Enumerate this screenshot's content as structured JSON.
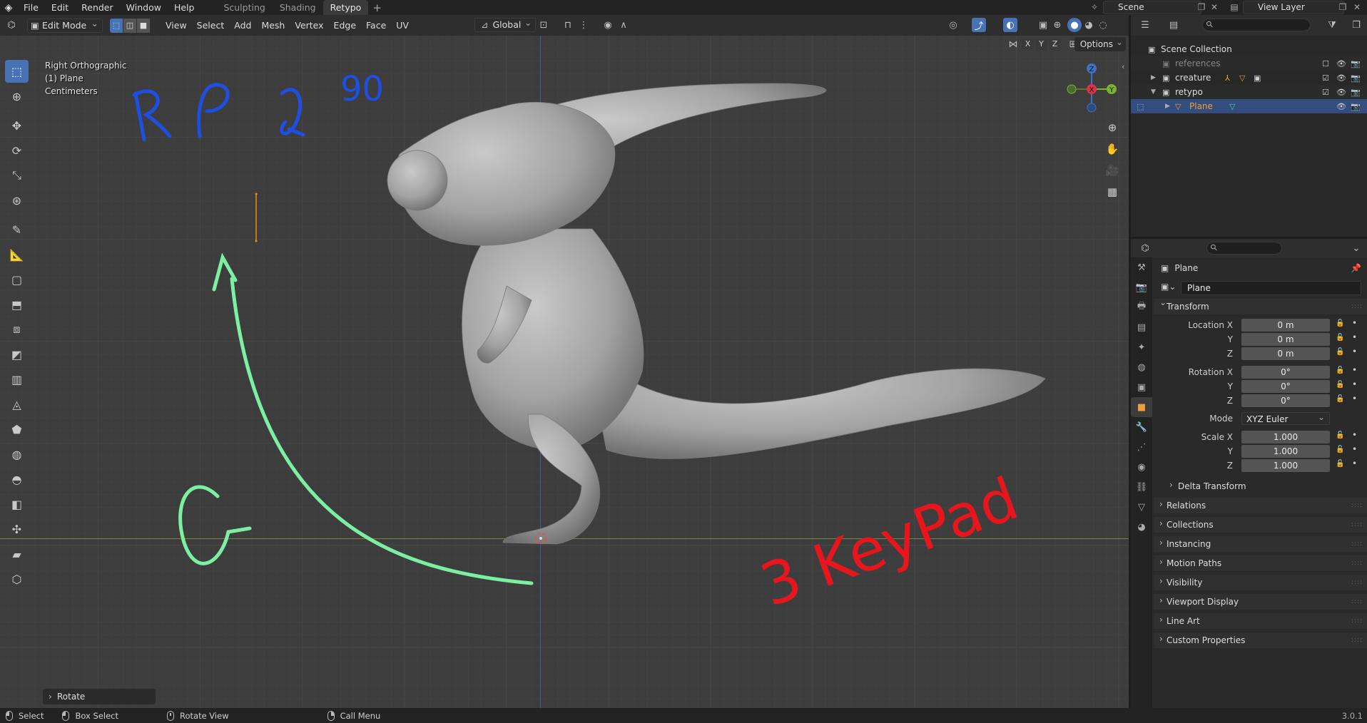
{
  "topbar": {
    "menus": [
      "File",
      "Edit",
      "Render",
      "Window",
      "Help"
    ],
    "workspaces": [
      "Sculpting",
      "Shading",
      "Retypo"
    ],
    "active_workspace": "Retypo",
    "add_tab": "+",
    "scene": "Scene",
    "view_layer": "View Layer"
  },
  "viewport": {
    "mode": "Edit Mode",
    "menus": [
      "View",
      "Select",
      "Add",
      "Mesh",
      "Vertex",
      "Edge",
      "Face",
      "UV"
    ],
    "transform_orientation": "Global",
    "options": "Options",
    "axes": [
      "X",
      "Y",
      "Z"
    ],
    "info": {
      "view": "Right Orthographic",
      "object": "(1) Plane",
      "units": "Centimeters"
    },
    "gizmo": {
      "z": "Z",
      "x": "X",
      "y": "Y"
    },
    "last_operator": "Rotate"
  },
  "annotations": {
    "top_left": "R",
    "degrees": "90",
    "grab": "G",
    "keypad": "3 KeyPad"
  },
  "outliner": {
    "root": "Scene Collection",
    "rows": [
      {
        "label": "references"
      },
      {
        "label": "creature"
      },
      {
        "label": "retypo"
      },
      {
        "label": "Plane"
      }
    ]
  },
  "properties": {
    "object_name": "Plane",
    "name_field": "Plane",
    "transform": {
      "title": "Transform",
      "location_label": "Location X",
      "rotation_label": "Rotation X",
      "scale_label": "Scale X",
      "y": "Y",
      "z": "Z",
      "location": [
        "0 m",
        "0 m",
        "0 m"
      ],
      "rotation": [
        "0°",
        "0°",
        "0°"
      ],
      "mode_label": "Mode",
      "mode": "XYZ Euler",
      "scale": [
        "1.000",
        "1.000",
        "1.000"
      ],
      "delta": "Delta Transform"
    },
    "panels": [
      "Relations",
      "Collections",
      "Instancing",
      "Motion Paths",
      "Visibility",
      "Viewport Display",
      "Line Art",
      "Custom Properties"
    ]
  },
  "statusbar": {
    "select": "Select",
    "box_select": "Box Select",
    "rotate_view": "Rotate View",
    "call_menu": "Call Menu",
    "version": "3.0.1"
  },
  "colors": {
    "accent": "#4772b3",
    "annotation_blue": "#1e4fe0",
    "annotation_green": "#7cf0a2",
    "annotation_red": "#e8161c",
    "selected_row": "#334d80"
  }
}
